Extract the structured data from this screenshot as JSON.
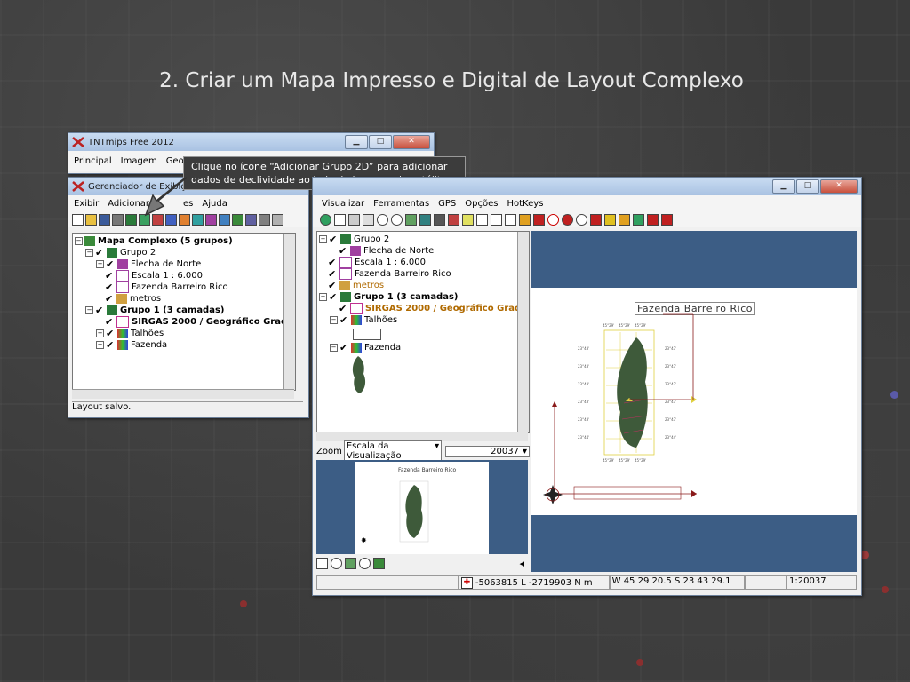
{
  "slide": {
    "title": "2. Criar um Mapa Impresso e Digital de Layout Complexo"
  },
  "tnt_window": {
    "title": "TNTmips Free 2012",
    "menu": [
      "Principal",
      "Imagem",
      "Geom"
    ]
  },
  "display_manager": {
    "title": "Gerenciador de Exibição",
    "menu": [
      "Exibir",
      "Adicionar",
      "es",
      "Ajuda"
    ],
    "tree": [
      {
        "label": "Mapa Complexo  (5 grupos)",
        "bold": true
      },
      {
        "label": "Grupo 2"
      },
      {
        "label": "Flecha de Norte"
      },
      {
        "label": "Escala 1 : 6.000"
      },
      {
        "label": "Fazenda Barreiro Rico"
      },
      {
        "label": "metros"
      },
      {
        "label": "Grupo 1   (3 camadas)",
        "bold": true
      },
      {
        "label": "SIRGAS 2000 / Geográfico Grade",
        "bold": true
      },
      {
        "label": "Talhões"
      },
      {
        "label": "Fazenda"
      }
    ],
    "status": "Layout salvo."
  },
  "callout": {
    "text": "Clique no ícone “Adicionar Grupo 2D” para adicionar dados de declividade ao lado da imagem de satélite."
  },
  "view_window": {
    "menu": [
      "Visualizar",
      "Ferramentas",
      "GPS",
      "Opções",
      "HotKeys"
    ],
    "tree": [
      {
        "label": "Grupo 2"
      },
      {
        "label": "Flecha de Norte"
      },
      {
        "label": "Escala 1 : 6.000"
      },
      {
        "label": "Fazenda Barreiro Rico"
      },
      {
        "label": "metros",
        "color": "#b06a00"
      },
      {
        "label": "Grupo 1   (3 camadas)",
        "bold": true
      },
      {
        "label": "SIRGAS 2000 / Geográfico Grade",
        "bold": true,
        "color": "#b06a00"
      },
      {
        "label": "Talhões"
      },
      {
        "label": "Fazenda"
      }
    ],
    "zoom_label": "Zoom",
    "zoom_mode": "Escala da Visualização",
    "zoom_value": "20037",
    "preview_title": "Fazenda Barreiro Rico",
    "layout_title": "Fazenda Barreiro Rico",
    "status_coords": "-5063815 L  -2719903 N m",
    "status_geo": "W 45 29 20.5  S 23 43 29.1",
    "status_scale": "1:20037"
  },
  "colors": {
    "accent_blue": "#3c5d85",
    "title_bar": "#a9c2e2",
    "callout_bg": "#3c3c3c"
  }
}
